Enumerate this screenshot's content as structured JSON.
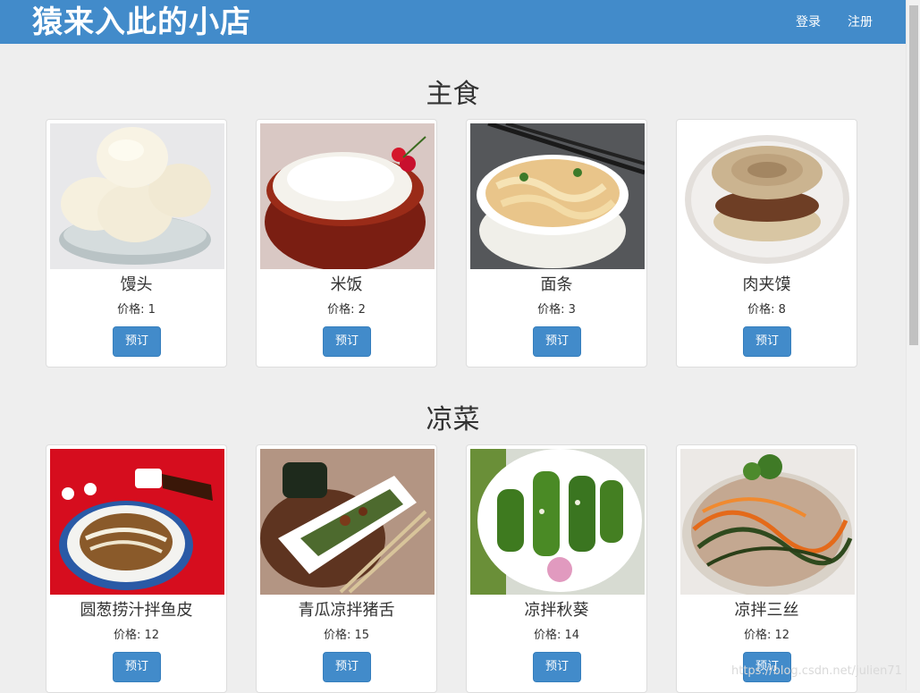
{
  "header": {
    "brand": "猿来入此的小店",
    "login": "登录",
    "register": "注册"
  },
  "price_prefix": "价格: ",
  "order_label": "预订",
  "sections": [
    {
      "title": "主食",
      "items": [
        {
          "name": "馒头",
          "price": "1"
        },
        {
          "name": "米饭",
          "price": "2"
        },
        {
          "name": "面条",
          "price": "3"
        },
        {
          "name": "肉夹馍",
          "price": "8"
        }
      ]
    },
    {
      "title": "凉菜",
      "items": [
        {
          "name": "圆葱捞汁拌鱼皮",
          "price": "12"
        },
        {
          "name": "青瓜凉拌猪舌",
          "price": "15"
        },
        {
          "name": "凉拌秋葵",
          "price": "14"
        },
        {
          "name": "凉拌三丝",
          "price": "12"
        }
      ]
    }
  ],
  "watermark": "https://blog.csdn.net/julien71"
}
